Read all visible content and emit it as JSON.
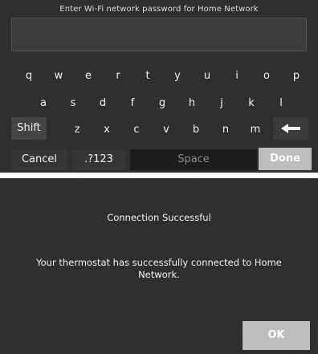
{
  "keyboard_screen": {
    "title": "Enter Wi-Fi network password for Home Network",
    "password_value": "",
    "row1": [
      "q",
      "w",
      "e",
      "r",
      "t",
      "y",
      "u",
      "i",
      "o",
      "p"
    ],
    "row2": [
      "a",
      "s",
      "d",
      "f",
      "g",
      "h",
      "j",
      "k",
      "l"
    ],
    "row3": [
      "z",
      "x",
      "c",
      "v",
      "b",
      "n",
      "m"
    ],
    "shift_label": "Shift",
    "backspace_icon": "left-arrow-icon",
    "cancel_label": "Cancel",
    "symbols_label": ".?123",
    "space_label": "Space",
    "done_label": "Done"
  },
  "confirmation_screen": {
    "title": "Connection Successful",
    "message": "Your thermostat has successfully connected to Home Network.",
    "ok_label": "OK"
  },
  "colors": {
    "background": "#2d2d2d",
    "primary_button": "#bdbdbd",
    "text": "#f2f2f2"
  }
}
